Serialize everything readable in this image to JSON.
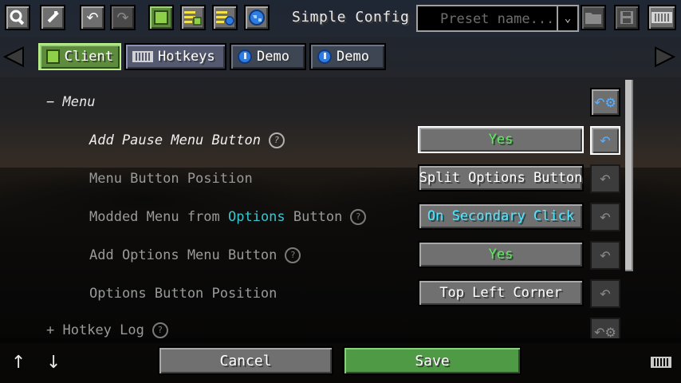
{
  "header": {
    "title": "Simple Config",
    "preset_placeholder": "Preset name...",
    "toolbar": [
      {
        "name": "search-button",
        "icon": "magnifier-icon",
        "active": false
      },
      {
        "name": "edit-button",
        "icon": "wand-icon",
        "active": false
      },
      {
        "name": "undo-button",
        "icon": "undo-icon",
        "active": false
      },
      {
        "name": "redo-button",
        "icon": "redo-icon",
        "active": false,
        "disabled": true
      },
      {
        "name": "client-config-button",
        "icon": "cube-icon",
        "active": true
      },
      {
        "name": "list-config-button",
        "icon": "list-cube-icon",
        "active": false
      },
      {
        "name": "list-server-button",
        "icon": "list-globe-icon",
        "active": false
      },
      {
        "name": "server-button",
        "icon": "globe-icon",
        "active": false
      }
    ],
    "right_icons": [
      "folder-icon",
      "save-icon",
      "keyboard-icon"
    ]
  },
  "tabs": [
    {
      "label": "Client",
      "icon": "cube-icon",
      "selected": true
    },
    {
      "label": "Hotkeys",
      "icon": "keyboard-icon",
      "selected": false
    },
    {
      "label": "Demo",
      "icon": "globe-icon",
      "selected": false
    },
    {
      "label": "Demo",
      "icon": "globe-icon",
      "selected": false
    }
  ],
  "section": {
    "prefix": "−",
    "label": "Menu"
  },
  "rows": [
    {
      "label": "Add Pause Menu Button",
      "value": "Yes",
      "value_color": "green",
      "help": true,
      "modified": true
    },
    {
      "label": "Menu Button Position",
      "value": "Split Options Button",
      "value_color": "white",
      "help": false,
      "modified": false
    },
    {
      "label_parts": [
        "Modded Menu from ",
        "Options",
        " Button"
      ],
      "value": "On Secondary Click",
      "value_color": "cyan",
      "help": true,
      "modified": false
    },
    {
      "label": "Add Options Menu Button",
      "value": "Yes",
      "value_color": "green",
      "help": true,
      "modified": false
    },
    {
      "label": "Options Button Position",
      "value": "Top Left Corner",
      "value_color": "white",
      "help": false,
      "modified": false
    }
  ],
  "next_section": {
    "prefix": "+",
    "label": "Hotkey Log"
  },
  "footer": {
    "cancel_label": "Cancel",
    "save_label": "Save",
    "up": "↑",
    "down": "↓"
  },
  "colors": {
    "selected_tab": "#5d8c3c",
    "value_green": "#62e864",
    "value_cyan": "#57e5ff",
    "save_button": "#4f9a44",
    "reset_active": "#5ab0ff"
  }
}
